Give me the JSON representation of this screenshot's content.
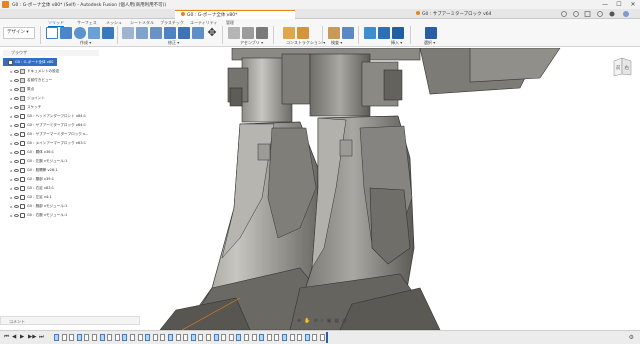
{
  "app": {
    "title": "G0 : G-ボーナ全体 v80* (Self) - Autodesk Fusion (個人用(商用利用不可))",
    "window_controls": [
      "—",
      "☐",
      "✕"
    ]
  },
  "doc_tabs": [
    {
      "label": "G0 : G-ボーナ全体 v80*",
      "active": true
    },
    {
      "label": "G0 : サブアーミターブロック v64",
      "active": false
    }
  ],
  "toolbar": {
    "workspace": "デザイン ▾",
    "tabs": [
      "ソリッド",
      "サーフェス",
      "メッシュ",
      "シートメタル",
      "プラスチック",
      "ユーティリティ",
      "管理"
    ],
    "active_tab": "ソリッド",
    "groups": [
      "作成 ▾",
      "修正 ▾",
      "アセンブリ ▾",
      "コンストラクション ▾",
      "検査 ▾",
      "挿入 ▾",
      "選択 ▾"
    ]
  },
  "browser": {
    "header": "ブラウザ",
    "root": "G0 : G-ボーナ全体 v80",
    "items": [
      "ドキュメントの設定",
      "名前付きビュー",
      "原点",
      "ジョイント",
      "スケッチ",
      "G0 : ヘッドアンダーフロント v84:1",
      "G0 : サブアーミターブロック v64:1",
      "G0 : サブアーマーミターブロック v...",
      "G0 : メインアーマーブロック v63:1",
      "G0 : 胴体 v36:1",
      "G0 : 左腕 vモジュール:1",
      "G0 : 股関節 v26:1",
      "G0 : 腰部 v39:1",
      "G0 : 右足 v83:1",
      "G0 : 左足 v4:1",
      "G0 : 腕部 vモジュール:1",
      "G0 : 右腕 vモジュール:1"
    ]
  },
  "viewcube": {
    "front": "前",
    "right": "右"
  },
  "comments": {
    "label": "コメント"
  },
  "nav_icons": [
    "orbit-icon",
    "pan-icon",
    "zoom-icon",
    "fit-icon",
    "display-icon",
    "grid-icon",
    "viewports-icon"
  ],
  "timeline": {
    "controls": [
      "⏮",
      "◀",
      "▶",
      "▶▶",
      "⏭"
    ]
  },
  "colors": {
    "accent": "#e8841a",
    "selection": "#2f6ec4",
    "model": "#8c8b84"
  }
}
